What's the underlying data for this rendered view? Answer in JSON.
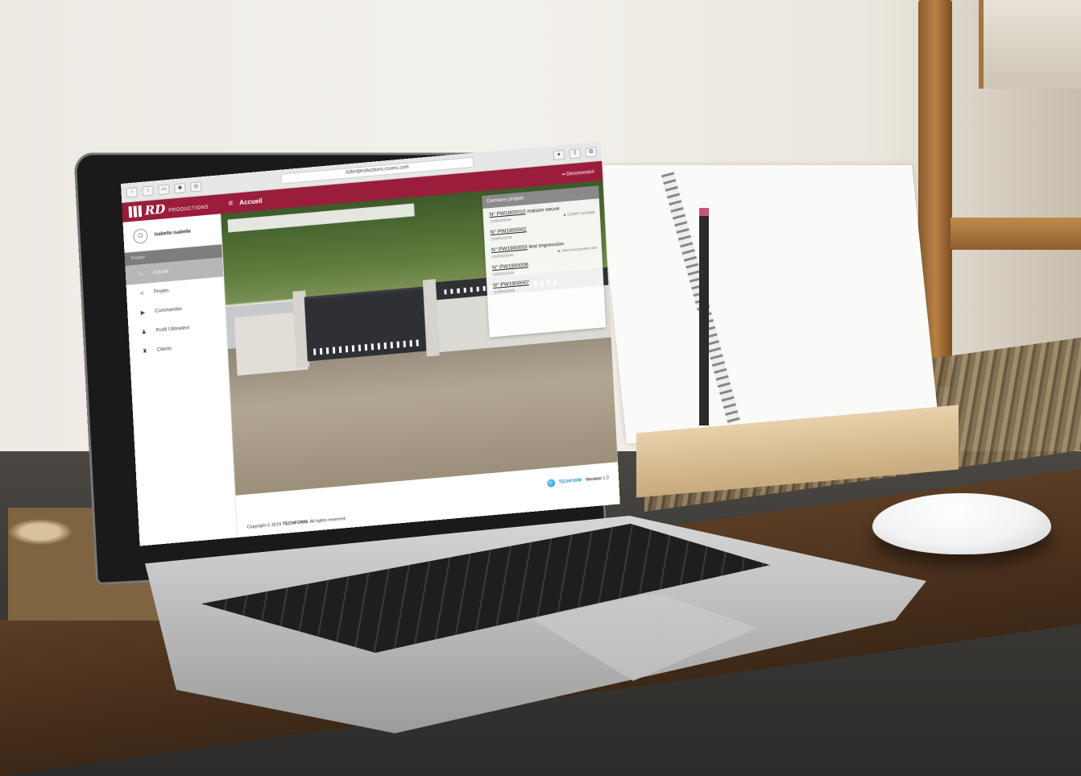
{
  "browser": {
    "url": "b2brdproductions.cssers.com",
    "back_icon": "chevron-left-icon",
    "forward_icon": "chevron-right-icon"
  },
  "header": {
    "logo_mark": "RD",
    "logo_text": "PRODUCTIONS",
    "title": "Accueil",
    "logout_label": "Déconnexion",
    "brand_color": "#9a1d3c"
  },
  "sidebar": {
    "username": "isabelle isabelle",
    "heading": "Projets",
    "items": [
      {
        "label": "Accueil",
        "icon": "home-icon",
        "active": true
      },
      {
        "label": "Projets",
        "icon": "share-icon",
        "active": false
      },
      {
        "label": "Commandes",
        "icon": "truck-icon",
        "active": false
      },
      {
        "label": "Profil Utilisateur",
        "icon": "user-icon",
        "active": false
      },
      {
        "label": "Clients",
        "icon": "people-icon",
        "active": false
      }
    ]
  },
  "recent": {
    "title": "Derniers projets",
    "projects": [
      {
        "number": "N° PW1800010",
        "name": " maison neuve",
        "date": "19/12/2018",
        "client": "GORRY NADINE"
      },
      {
        "number": "N° PW1900002",
        "name": "",
        "date": "16/01/2019",
        "client": ""
      },
      {
        "number": "N° PW1900003",
        "name": " test impression",
        "date": "16/01/2019",
        "client": "client test premier test"
      },
      {
        "number": "N° PW1900006",
        "name": "",
        "date": "28/01/2019",
        "client": ""
      },
      {
        "number": "N° PW1900007",
        "name": "",
        "date": "28/01/2019",
        "client": ""
      }
    ]
  },
  "footer": {
    "copyright_prefix": "Copyright © 2019 ",
    "copyright_brand": "TECHFORM.",
    "copyright_suffix": " All rights reserved.",
    "techform": "TECHFORM",
    "version_label": "Version",
    "version_value": "1.0"
  }
}
